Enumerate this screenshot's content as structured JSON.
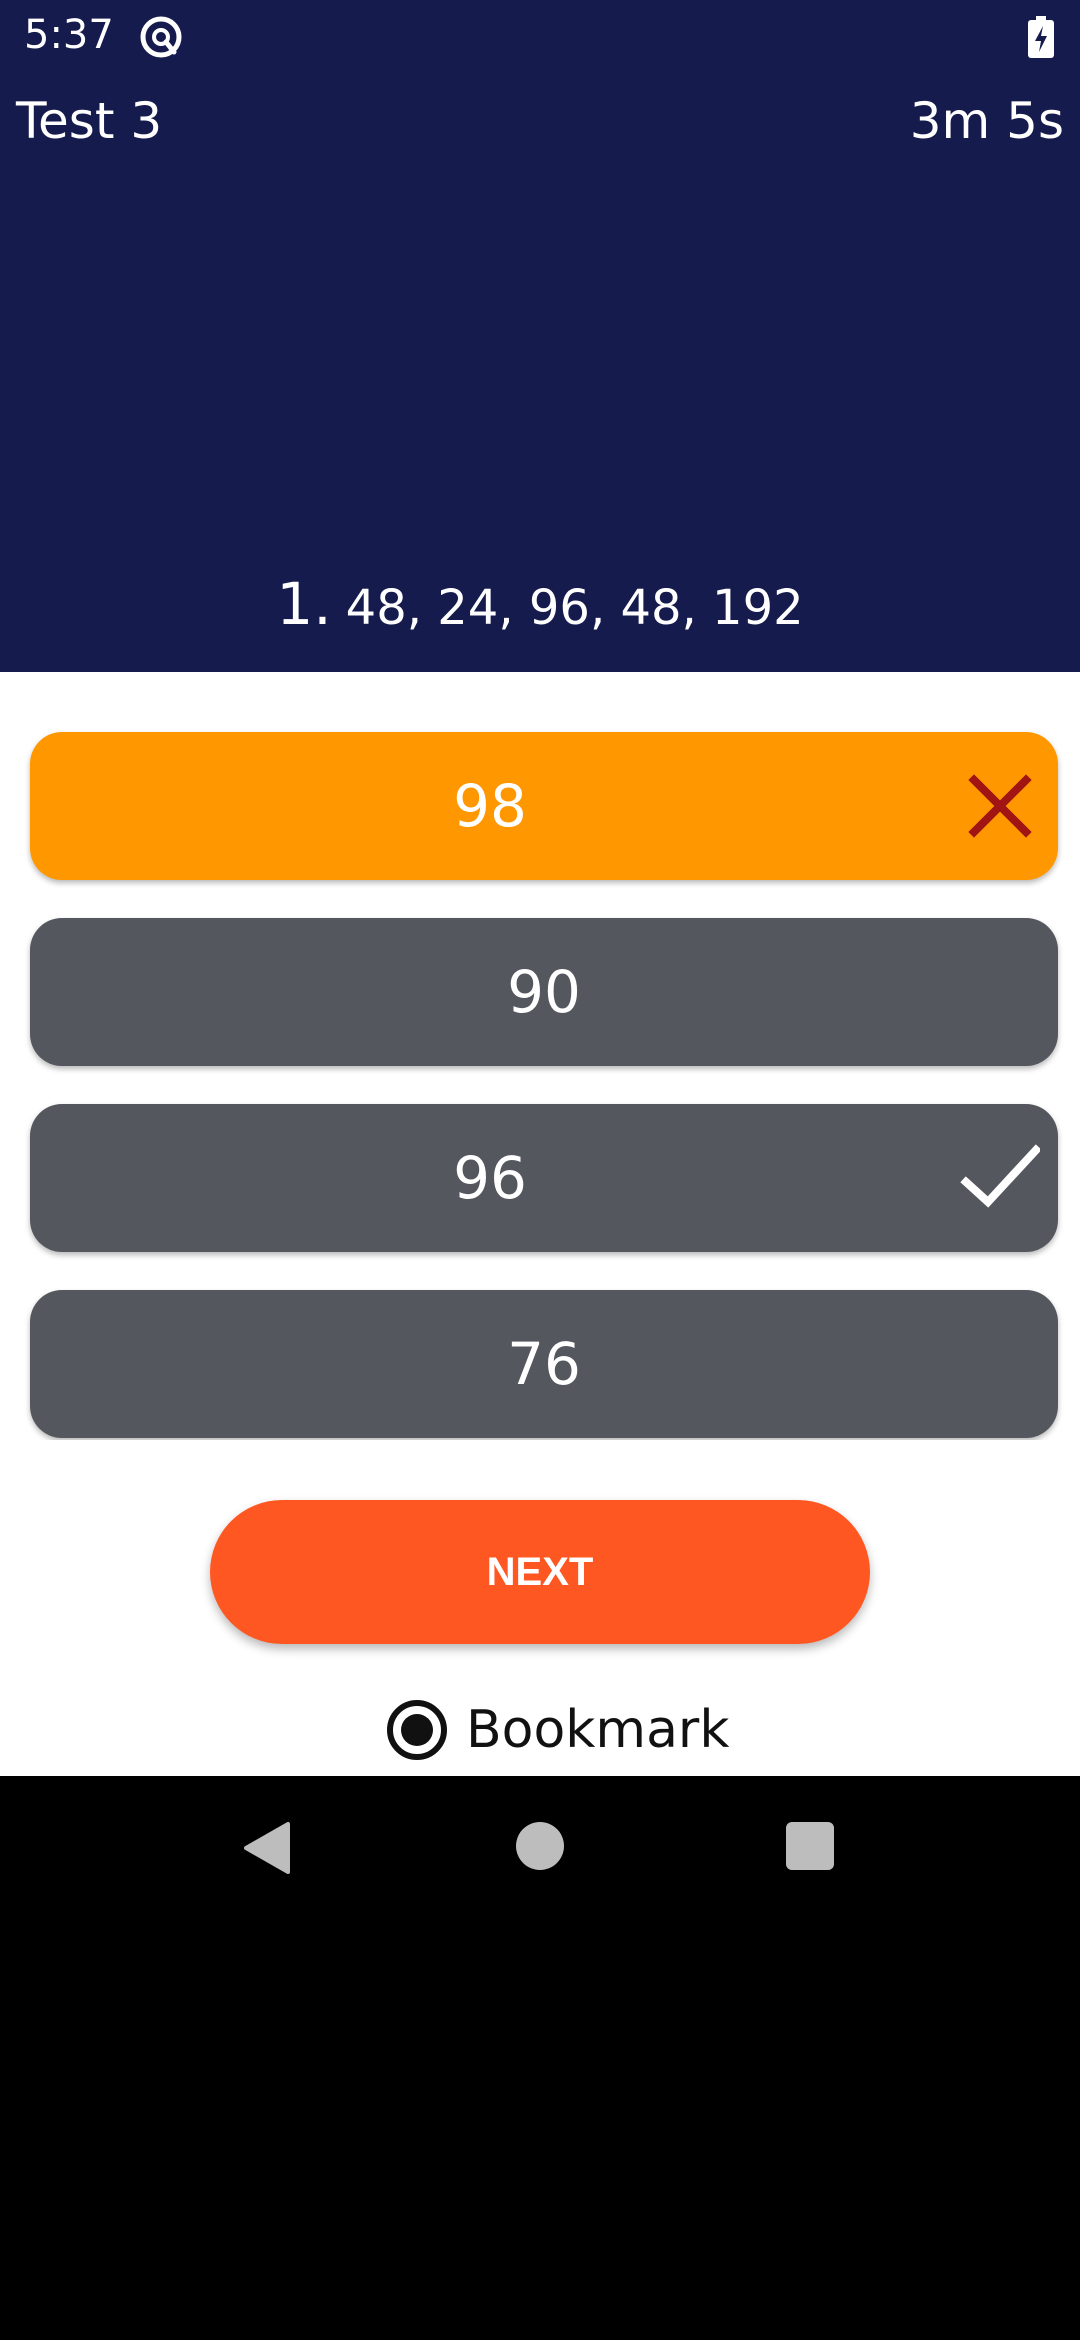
{
  "status_bar": {
    "time": "5:37"
  },
  "header": {
    "title": "Test 3",
    "timer": "3m 5s"
  },
  "question": {
    "number": "1.",
    "text": "48, 24, 96, 48, 192"
  },
  "options": [
    {
      "label": "98",
      "state": "selected-wrong",
      "icon": "close-icon",
      "color": "#ff9701",
      "icon_color": "#a01414"
    },
    {
      "label": "90",
      "state": "unselected",
      "color": "#55575f"
    },
    {
      "label": "96",
      "state": "correct",
      "icon": "check-icon",
      "color": "#55575f",
      "icon_color": "#ffffff"
    },
    {
      "label": "76",
      "state": "unselected",
      "color": "#55575f"
    }
  ],
  "actions": {
    "next_label": "NEXT",
    "bookmark_label": "Bookmark",
    "next_color": "#ff5722"
  },
  "colors": {
    "header_bg": "#161b4d"
  }
}
